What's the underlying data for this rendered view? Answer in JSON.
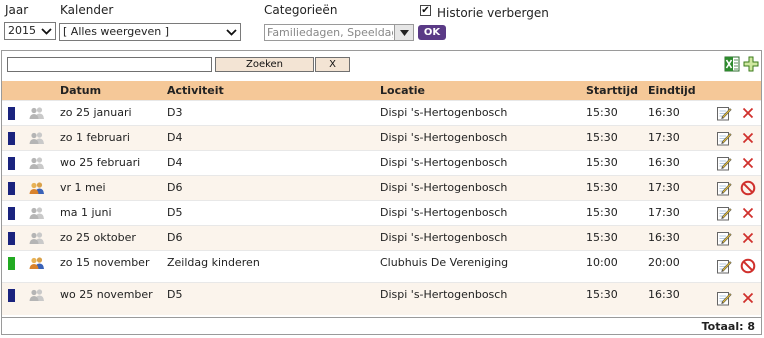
{
  "filters": {
    "jaar_label": "Jaar",
    "jaar_value": "2015",
    "kalender_label": "Kalender",
    "kalender_value": "[ Alles weergeven ]",
    "categorieen_label": "Categorieën",
    "categorieen_value": "Familiedagen, Speeldag",
    "ok_label": "OK",
    "historie_label": "Historie verbergen",
    "historie_checked": true
  },
  "search": {
    "value": "",
    "zoeken_label": "Zoeken",
    "clear_label": "X"
  },
  "table": {
    "headers": {
      "datum": "Datum",
      "activiteit": "Activiteit",
      "locatie": "Locatie",
      "starttijd": "Starttijd",
      "eindtijd": "Eindtijd"
    },
    "rows": [
      {
        "color": "#1a237e",
        "users": "grey",
        "datum": "zo 25 januari",
        "activiteit": "D3",
        "locatie": "Dispi 's-Hertogenbosch",
        "starttijd": "15:30",
        "eindtijd": "16:30",
        "action": "delete"
      },
      {
        "color": "#1a237e",
        "users": "grey",
        "datum": "zo 1 februari",
        "activiteit": "D4",
        "locatie": "Dispi 's-Hertogenbosch",
        "starttijd": "15:30",
        "eindtijd": "17:30",
        "action": "delete"
      },
      {
        "color": "#1a237e",
        "users": "grey",
        "datum": "wo 25 februari",
        "activiteit": "D4",
        "locatie": "Dispi 's-Hertogenbosch",
        "starttijd": "15:30",
        "eindtijd": "16:30",
        "action": "delete"
      },
      {
        "color": "#1a237e",
        "users": "color",
        "datum": "vr 1 mei",
        "activiteit": "D6",
        "locatie": "Dispi 's-Hertogenbosch",
        "starttijd": "15:30",
        "eindtijd": "17:30",
        "action": "blocked"
      },
      {
        "color": "#1a237e",
        "users": "grey",
        "datum": "ma 1 juni",
        "activiteit": "D5",
        "locatie": "Dispi 's-Hertogenbosch",
        "starttijd": "15:30",
        "eindtijd": "17:30",
        "action": "delete"
      },
      {
        "color": "#1a237e",
        "users": "grey",
        "datum": "zo 25 oktober",
        "activiteit": "D6",
        "locatie": "Dispi 's-Hertogenbosch",
        "starttijd": "15:30",
        "eindtijd": "16:30",
        "action": "delete"
      },
      {
        "color": "#22aa22",
        "users": "color",
        "datum": "zo 15 november",
        "activiteit": "Zeildag kinderen",
        "locatie": "Clubhuis De Vereniging",
        "starttijd": "10:00",
        "eindtijd": "20:00",
        "action": "blocked"
      },
      {
        "color": "#1a237e",
        "users": "grey",
        "datum": "wo 25 november",
        "activiteit": "D5",
        "locatie": "Dispi 's-Hertogenbosch",
        "starttijd": "15:30",
        "eindtijd": "16:30",
        "action": "delete"
      }
    ]
  },
  "totaal": "Totaal: 8"
}
